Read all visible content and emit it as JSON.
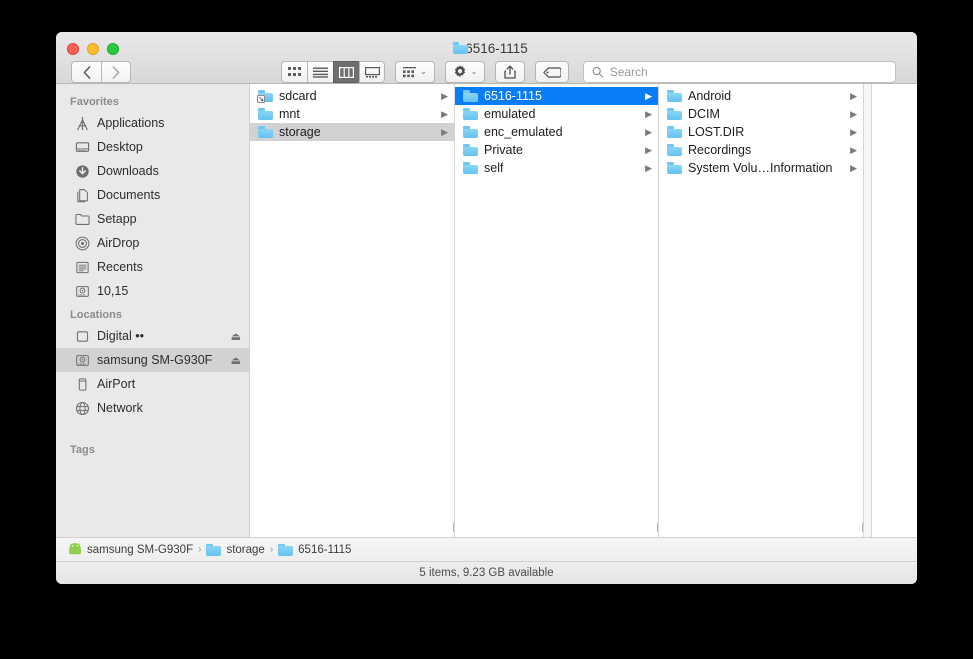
{
  "window": {
    "title": "6516-1115",
    "traffic_lights": [
      {
        "name": "close",
        "color": "#ff5f57"
      },
      {
        "name": "minimize",
        "color": "#ffbd2e"
      },
      {
        "name": "zoom",
        "color": "#28c940"
      }
    ]
  },
  "toolbar": {
    "back_glyph": "‹",
    "forward_glyph": "›",
    "view_modes": [
      {
        "name": "icon-view",
        "active": false
      },
      {
        "name": "list-view",
        "active": false
      },
      {
        "name": "column-view",
        "active": true
      },
      {
        "name": "gallery-view",
        "active": false
      }
    ],
    "group_button": "group-items-button",
    "action_button": "action-gear-button",
    "share_button": "share-button",
    "tags_button": "tags-button",
    "chevron_glyph": "⌄"
  },
  "search": {
    "placeholder": "Search",
    "value": ""
  },
  "sidebar": {
    "sections": [
      {
        "header": "Favorites",
        "items": [
          {
            "label": "Applications",
            "icon": "applications-icon",
            "selected": false,
            "eject": false
          },
          {
            "label": "Desktop",
            "icon": "desktop-icon",
            "selected": false,
            "eject": false
          },
          {
            "label": "Downloads",
            "icon": "downloads-icon",
            "selected": false,
            "eject": false
          },
          {
            "label": "Documents",
            "icon": "documents-icon",
            "selected": false,
            "eject": false
          },
          {
            "label": "Setapp",
            "icon": "folder-icon",
            "selected": false,
            "eject": false
          },
          {
            "label": "AirDrop",
            "icon": "airdrop-icon",
            "selected": false,
            "eject": false
          },
          {
            "label": "Recents",
            "icon": "recents-icon",
            "selected": false,
            "eject": false
          },
          {
            "label": "10,15",
            "icon": "harddisk-icon",
            "selected": false,
            "eject": false
          }
        ]
      },
      {
        "header": "Locations",
        "items": [
          {
            "label": "Digital ••",
            "icon": "external-disk-icon",
            "selected": false,
            "eject": true
          },
          {
            "label": "samsung SM-G930F",
            "icon": "harddisk-icon",
            "selected": true,
            "eject": true
          },
          {
            "label": "AirPort",
            "icon": "airport-icon",
            "selected": false,
            "eject": false
          },
          {
            "label": "Network",
            "icon": "network-globe-icon",
            "selected": false,
            "eject": false
          }
        ]
      },
      {
        "header": "Tags",
        "items": []
      }
    ]
  },
  "columns": [
    {
      "name": "column-1",
      "items": [
        {
          "label": "sdcard",
          "alias": true,
          "selected": "none",
          "has_arrow": true
        },
        {
          "label": "mnt",
          "alias": false,
          "selected": "none",
          "has_arrow": true
        },
        {
          "label": "storage",
          "alias": false,
          "selected": "gray",
          "has_arrow": true
        }
      ]
    },
    {
      "name": "column-2",
      "items": [
        {
          "label": "6516-1115",
          "alias": false,
          "selected": "blue",
          "has_arrow": true
        },
        {
          "label": "emulated",
          "alias": false,
          "selected": "none",
          "has_arrow": true
        },
        {
          "label": "enc_emulated",
          "alias": false,
          "selected": "none",
          "has_arrow": true
        },
        {
          "label": "Private",
          "alias": false,
          "selected": "none",
          "has_arrow": true
        },
        {
          "label": "self",
          "alias": false,
          "selected": "none",
          "has_arrow": true
        }
      ]
    },
    {
      "name": "column-3",
      "items": [
        {
          "label": "Android",
          "alias": false,
          "selected": "none",
          "has_arrow": true
        },
        {
          "label": "DCIM",
          "alias": false,
          "selected": "none",
          "has_arrow": true
        },
        {
          "label": "LOST.DIR",
          "alias": false,
          "selected": "none",
          "has_arrow": true
        },
        {
          "label": "Recordings",
          "alias": false,
          "selected": "none",
          "has_arrow": true
        },
        {
          "label": "System Volu…Information",
          "alias": false,
          "selected": "none",
          "has_arrow": true
        }
      ]
    }
  ],
  "pathbar": {
    "crumbs": [
      {
        "label": "samsung SM-G930F",
        "icon": "android-device-icon"
      },
      {
        "label": "storage",
        "icon": "folder-icon"
      },
      {
        "label": "6516-1115",
        "icon": "folder-icon"
      }
    ],
    "separator": "›"
  },
  "statusbar": {
    "text": "5 items, 9.23 GB available"
  },
  "resize_handle_glyph": "||"
}
